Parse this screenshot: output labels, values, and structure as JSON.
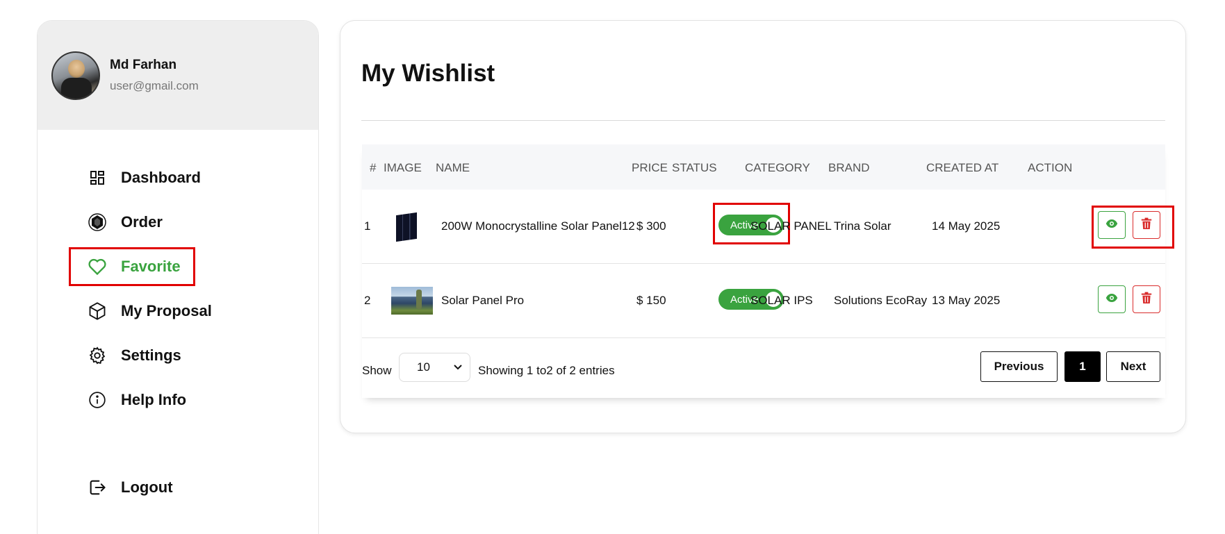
{
  "colors": {
    "accent_green": "#3aa33f",
    "danger_red": "#d92b2b",
    "highlight_red": "#e10000"
  },
  "profile": {
    "name": "Md Farhan",
    "email": "user@gmail.com"
  },
  "sidebar": {
    "items": [
      {
        "label": "Dashboard",
        "icon": "dashboard-icon"
      },
      {
        "label": "Order",
        "icon": "order-icon"
      },
      {
        "label": "Favorite",
        "icon": "heart-icon",
        "active": true
      },
      {
        "label": "My Proposal",
        "icon": "box-icon"
      },
      {
        "label": "Settings",
        "icon": "gear-icon"
      },
      {
        "label": "Help Info",
        "icon": "info-icon"
      }
    ],
    "logout": {
      "label": "Logout",
      "icon": "logout-icon"
    }
  },
  "main": {
    "title": "My Wishlist",
    "table": {
      "headers": [
        "#",
        "IMAGE",
        "NAME",
        "PRICE",
        "STATUS",
        "CATEGORY",
        "BRAND",
        "CREATED AT",
        "ACTION"
      ],
      "rows": [
        {
          "index": "1",
          "image": "solar-panel-thumbnail",
          "name": "200W Monocrystalline Solar Panel12",
          "price": "$ 300",
          "status": "Active",
          "category": "SOLAR PANEL",
          "brand": "Trina Solar",
          "created_at": "14 May 2025"
        },
        {
          "index": "2",
          "image": "solar-field-thumbnail",
          "name": "Solar Panel Pro",
          "price": "$ 150",
          "status": "Active",
          "category": "SOLAR IPS",
          "brand": "Solutions EcoRay",
          "created_at": "13 May 2025"
        }
      ]
    },
    "footer": {
      "show_label": "Show",
      "page_size": "10",
      "info": "Showing 1  to2  of 2 entries",
      "previous": "Previous",
      "current_page": "1",
      "next": "Next"
    }
  }
}
